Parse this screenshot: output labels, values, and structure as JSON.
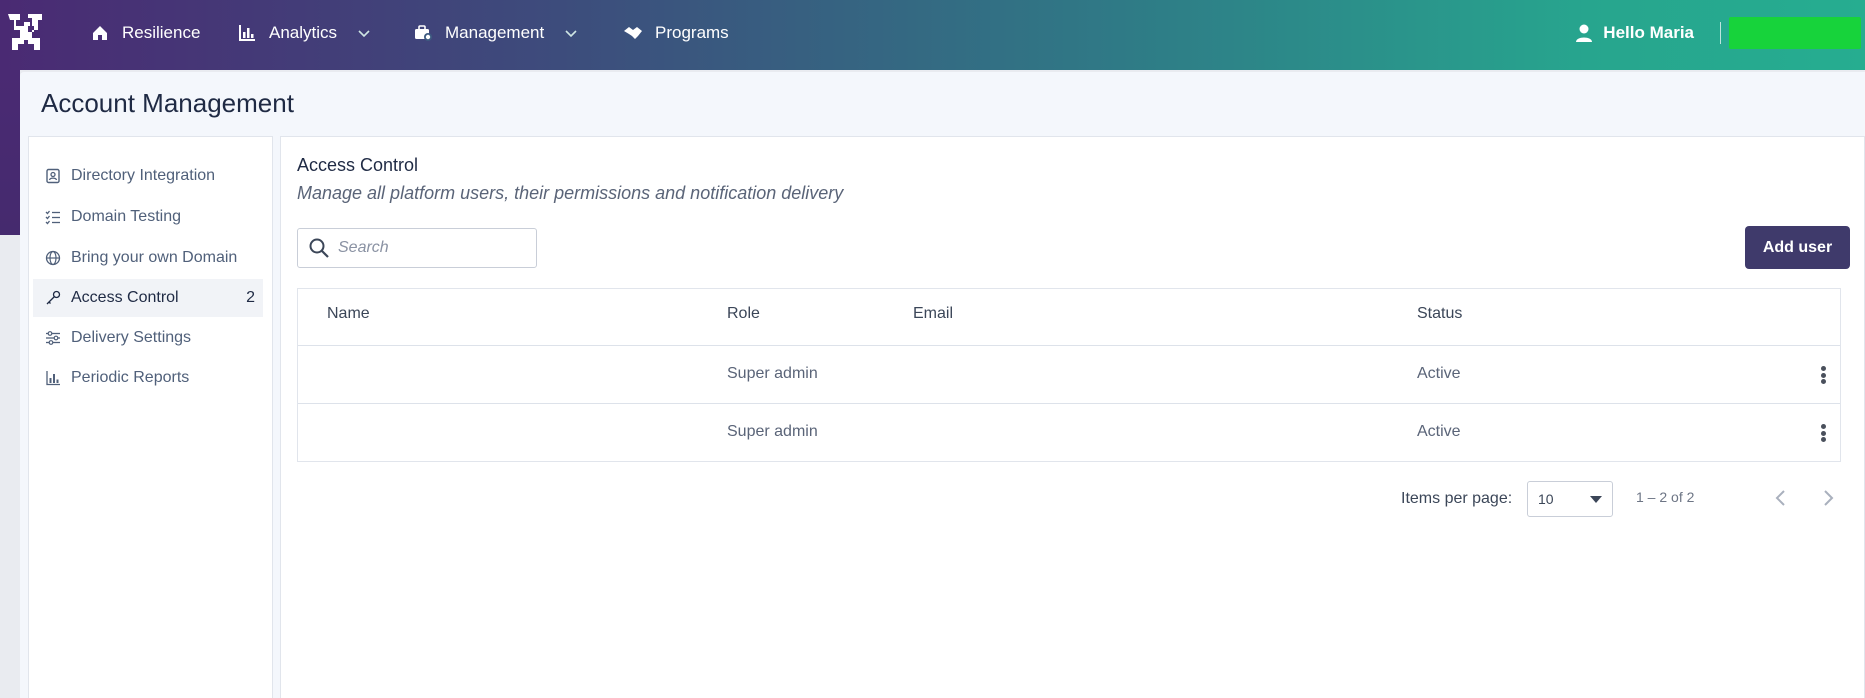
{
  "nav": {
    "items": [
      {
        "label": "Resilience",
        "icon": "home-icon"
      },
      {
        "label": "Analytics",
        "icon": "bar-chart-icon",
        "has_dropdown": true
      },
      {
        "label": "Management",
        "icon": "briefcase-gear-icon",
        "has_dropdown": true
      },
      {
        "label": "Programs",
        "icon": "handshake-icon"
      }
    ],
    "greeting": "Hello Maria",
    "colors": {
      "gradient_start": "#4a2a73",
      "gradient_end": "#26ad90",
      "green_button": "#17d33b"
    }
  },
  "page": {
    "title": "Account Management"
  },
  "sidebar": {
    "items": [
      {
        "label": "Directory Integration",
        "icon": "contact-card-icon"
      },
      {
        "label": "Domain Testing",
        "icon": "checklist-icon"
      },
      {
        "label": "Bring your own Domain",
        "icon": "globe-icon"
      },
      {
        "label": "Access Control",
        "icon": "key-icon",
        "count": "2",
        "active": true
      },
      {
        "label": "Delivery Settings",
        "icon": "sliders-icon"
      },
      {
        "label": "Periodic Reports",
        "icon": "bar-chart-icon"
      }
    ]
  },
  "section": {
    "title": "Access Control",
    "subtitle": "Manage all platform users, their permissions and notification delivery",
    "search_placeholder": "Search",
    "add_button": "Add user",
    "accent": "#3f3a6b"
  },
  "table": {
    "headers": [
      "Name",
      "Role",
      "Email",
      "Status"
    ],
    "rows": [
      {
        "name": "",
        "role": "Super admin",
        "email": "",
        "status": "Active"
      },
      {
        "name": "",
        "role": "Super admin",
        "email": "",
        "status": "Active"
      }
    ]
  },
  "pagination": {
    "items_per_page_label": "Items per page:",
    "items_per_page_value": "10",
    "range": "1 – 2 of 2"
  }
}
